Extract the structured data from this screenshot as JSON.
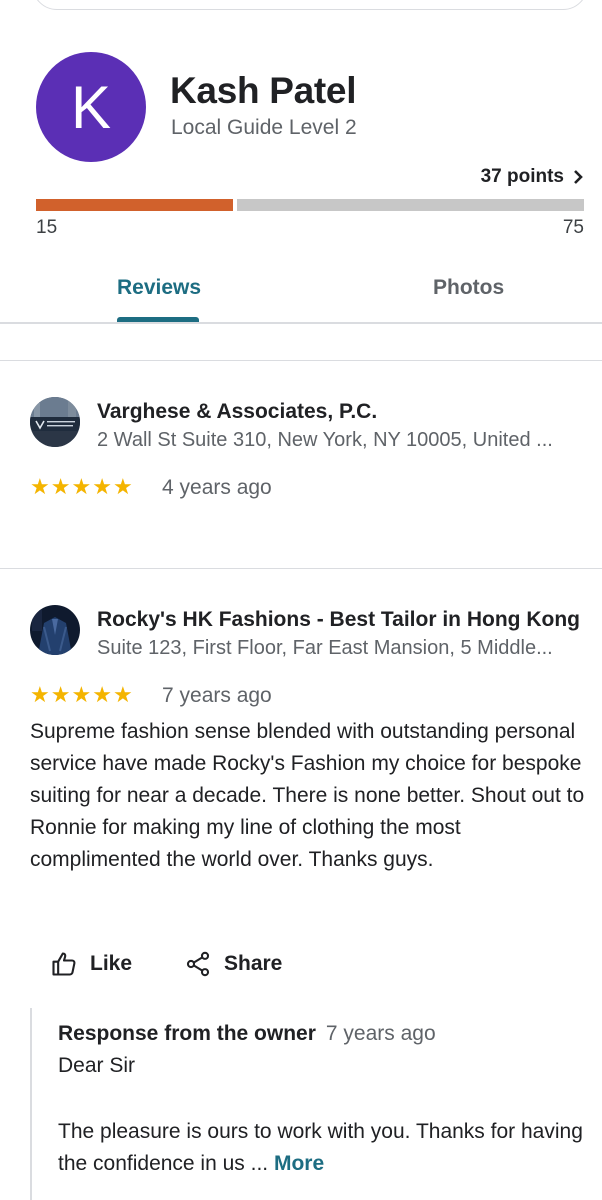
{
  "profile": {
    "avatar_letter": "K",
    "avatar_color": "#5b2fb5",
    "name": "Kash Patel",
    "level": "Local Guide Level 2",
    "points": "37 points",
    "progress_min": "15",
    "progress_max": "75",
    "progress_fraction": 0.367,
    "progress_color": "#d1612c"
  },
  "tabs": [
    {
      "label": "Reviews",
      "active": true
    },
    {
      "label": "Photos",
      "active": false
    }
  ],
  "accent_color": "#1d6d82",
  "reviews": [
    {
      "place_name": "Varghese & Associates, P.C.",
      "address": "2 Wall St Suite 310, New York, NY 10005, United ...",
      "rating": 5,
      "stars": "★★★★★",
      "time": "4 years ago"
    },
    {
      "place_name": "Rocky's HK Fashions - Best Tailor in Hong Kong",
      "address": "Suite 123, First Floor, Far East Mansion, 5 Middle...",
      "rating": 5,
      "stars": "★★★★★",
      "time": "7 years ago",
      "text": "Supreme fashion sense blended with outstanding personal service have made Rocky's Fashion my choice for bespoke suiting for near a decade. There is none better. Shout out to Ronnie for making my line of clothing the most complimented the world over. Thanks guys.",
      "actions": {
        "like": "Like",
        "share": "Share"
      },
      "owner_response": {
        "title": "Response from the owner",
        "time": "7 years ago",
        "greeting": "Dear Sir",
        "body": "The pleasure is ours to work with you. Thanks for having the confidence in us ...",
        "more": "More"
      }
    }
  ]
}
